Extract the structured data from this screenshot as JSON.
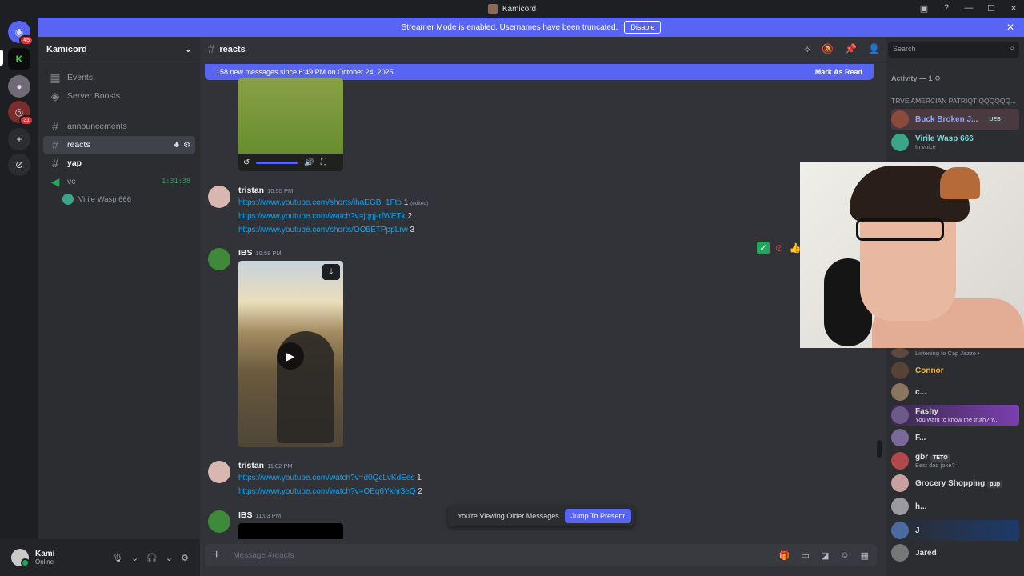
{
  "window": {
    "title": "Kamicord"
  },
  "banner": {
    "text": "Streamer Mode is enabled. Usernames have been truncated.",
    "disable_label": "Disable"
  },
  "servers": [
    {
      "name": "discord-home",
      "badge": "45"
    },
    {
      "name": "server-k",
      "badge": ""
    },
    {
      "name": "server-2",
      "badge": ""
    },
    {
      "name": "server-3",
      "badge": "31"
    }
  ],
  "guild": {
    "name": "Kamicord"
  },
  "channels": {
    "events": "Events",
    "boosts": "Server Boosts",
    "announcements": "announcements",
    "reacts": "reacts",
    "yap": "yap",
    "vc": "vc",
    "vc_time": "1:31:38",
    "vc_user": "Virile Wasp 666"
  },
  "user": {
    "name": "Kami",
    "status": "Online"
  },
  "chat": {
    "channel": "reacts",
    "new_messages": "158 new messages since 6:49 PM on October 24, 2025",
    "mark_read": "Mark As Read",
    "placeholder": "Message #reacts",
    "older_text": "You're Viewing Older Messages",
    "jump_label": "Jump To Present",
    "messages": [
      {
        "author": "tristan",
        "time": "10:55 PM",
        "links": [
          {
            "url": "https://www.youtube.com/shorts/ihaEGB_1Fto",
            "n": "1",
            "edited": "(edited)"
          },
          {
            "url": "https://www.youtube.com/watch?v=jqqj-rfWETk",
            "n": "2"
          },
          {
            "url": "https://www.youtube.com/shorts/OO5ETPppLrw",
            "n": "3"
          }
        ]
      },
      {
        "author": "IBS",
        "time": "10:58 PM"
      },
      {
        "author": "tristan",
        "time": "11:02 PM",
        "links": [
          {
            "url": "https://www.youtube.com/watch?v=d0QcLvKdEes",
            "n": "1"
          },
          {
            "url": "https://www.youtube.com/watch?v=OEq6Yknr3eQ",
            "n": "2"
          }
        ]
      },
      {
        "author": "IBS",
        "time": "11:03 PM"
      }
    ]
  },
  "search": {
    "placeholder": "Search"
  },
  "members": {
    "activity_header": "Activity — 1",
    "role_header": "TRVE AMERCIAN PATRIQT QQQQQQ...",
    "list": [
      {
        "name": "Buck Broken J...",
        "tag": "UEB",
        "status": "",
        "color": "#8fa8ff"
      },
      {
        "name": "Virile Wasp 666",
        "status": "In voice",
        "color": "#7bd4d0"
      },
      {
        "name": "",
        "status": "Listening to Cap Jazzo •",
        "color": "#dbdee1"
      },
      {
        "name": "Connor",
        "status": "",
        "color": "#f0b232"
      },
      {
        "name": "c...",
        "status": "",
        "color": "#dbdee1"
      },
      {
        "name": "Fashy",
        "status": "You want to know the truth? Y...",
        "color": "#dbdee1"
      },
      {
        "name": "F...",
        "status": "",
        "color": "#dbdee1"
      },
      {
        "name": "gbr",
        "tag": "TETO",
        "status": "Best dad joke?",
        "color": "#dbdee1"
      },
      {
        "name": "Grocery Shopping",
        "tag": "pup",
        "status": "",
        "color": "#dbdee1"
      },
      {
        "name": "h...",
        "status": "",
        "color": "#dbdee1"
      },
      {
        "name": "J",
        "status": "",
        "color": "#dbdee1"
      },
      {
        "name": "Jared",
        "status": "",
        "color": "#dbdee1"
      }
    ]
  },
  "colors": {
    "accent": "#5865f2",
    "link": "#00a8fc",
    "online": "#23a55a"
  }
}
